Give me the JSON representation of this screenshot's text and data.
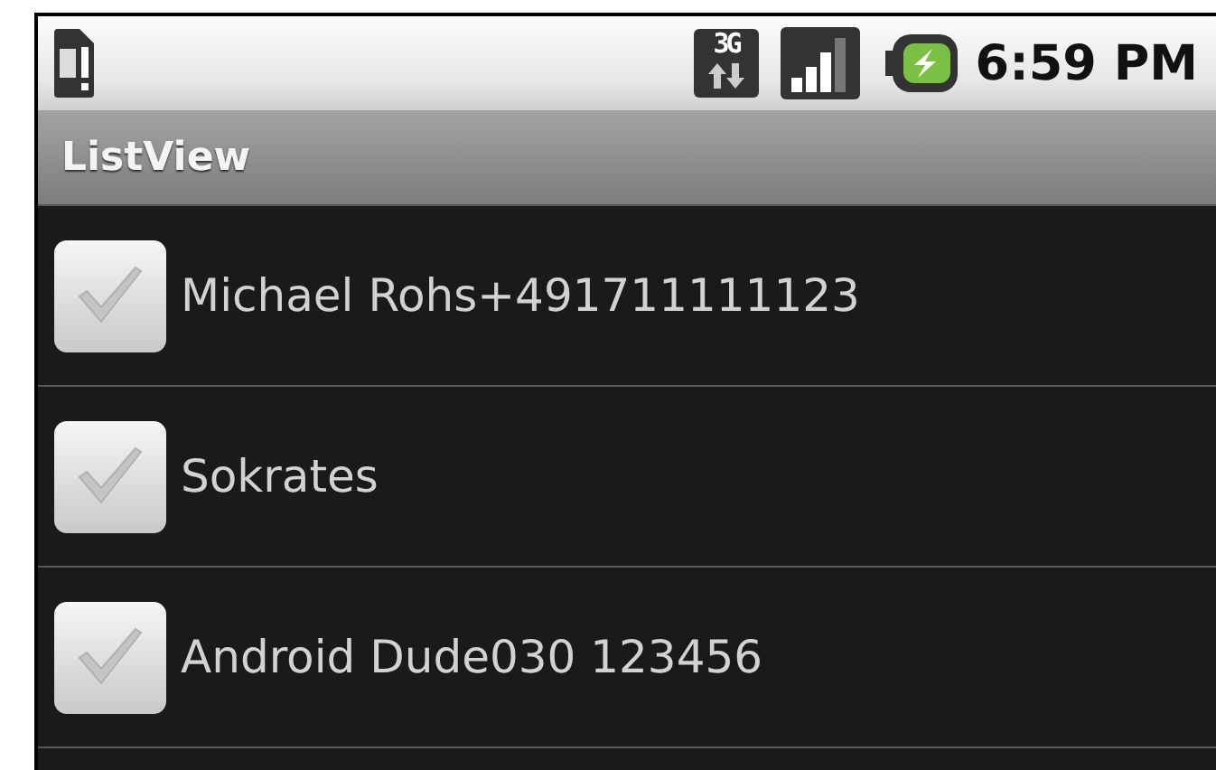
{
  "status_bar": {
    "network_type": "3G",
    "time": "6:59 PM"
  },
  "title_bar": {
    "title": "ListView"
  },
  "list": [
    {
      "label": "Michael Rohs+491711111123",
      "checked": false
    },
    {
      "label": "Sokrates",
      "checked": false
    },
    {
      "label": "Android Dude030 123456",
      "checked": false
    }
  ]
}
